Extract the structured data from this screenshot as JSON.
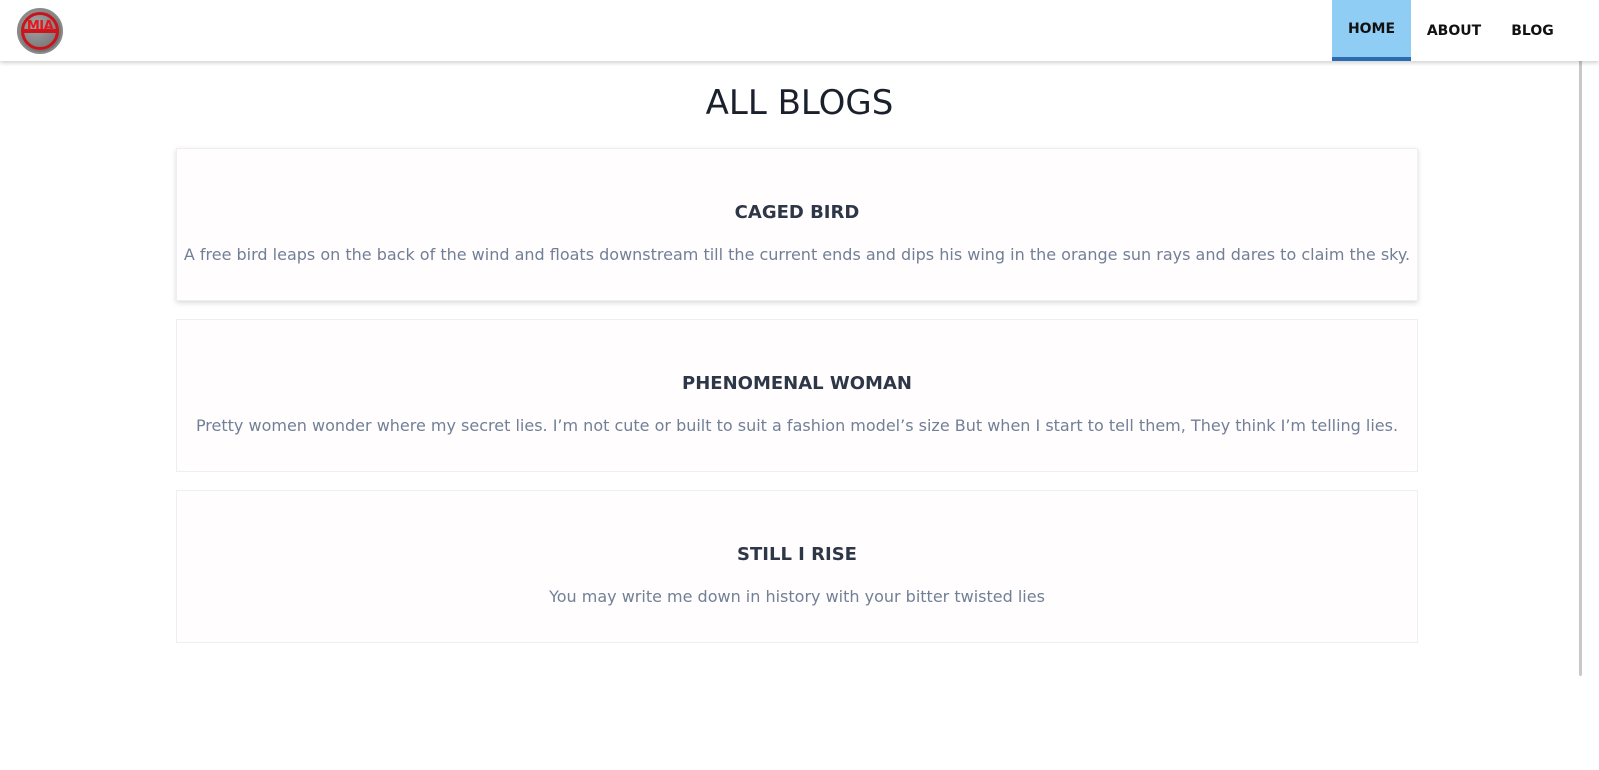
{
  "navbar": {
    "logo_text": "MIA",
    "items": [
      {
        "label": "HOME",
        "active": true
      },
      {
        "label": "ABOUT",
        "active": false
      },
      {
        "label": "BLOG",
        "active": false
      }
    ],
    "active_color": "#90cdf4",
    "active_border_color": "#2b6cb0"
  },
  "main": {
    "title": "ALL BLOGS",
    "posts": [
      {
        "title": "CAGED BIRD",
        "excerpt": "A free bird leaps on the back of the wind and floats downstream till the current ends and dips his wing in the orange sun rays and dares to claim the sky."
      },
      {
        "title": "PHENOMENAL WOMAN",
        "excerpt": "Pretty women wonder where my secret lies. I’m not cute or built to suit a fashion model’s size But when I start to tell them, They think I’m telling lies."
      },
      {
        "title": "STILL I RISE",
        "excerpt": "You may write me down in history with your bitter twisted lies"
      }
    ]
  }
}
